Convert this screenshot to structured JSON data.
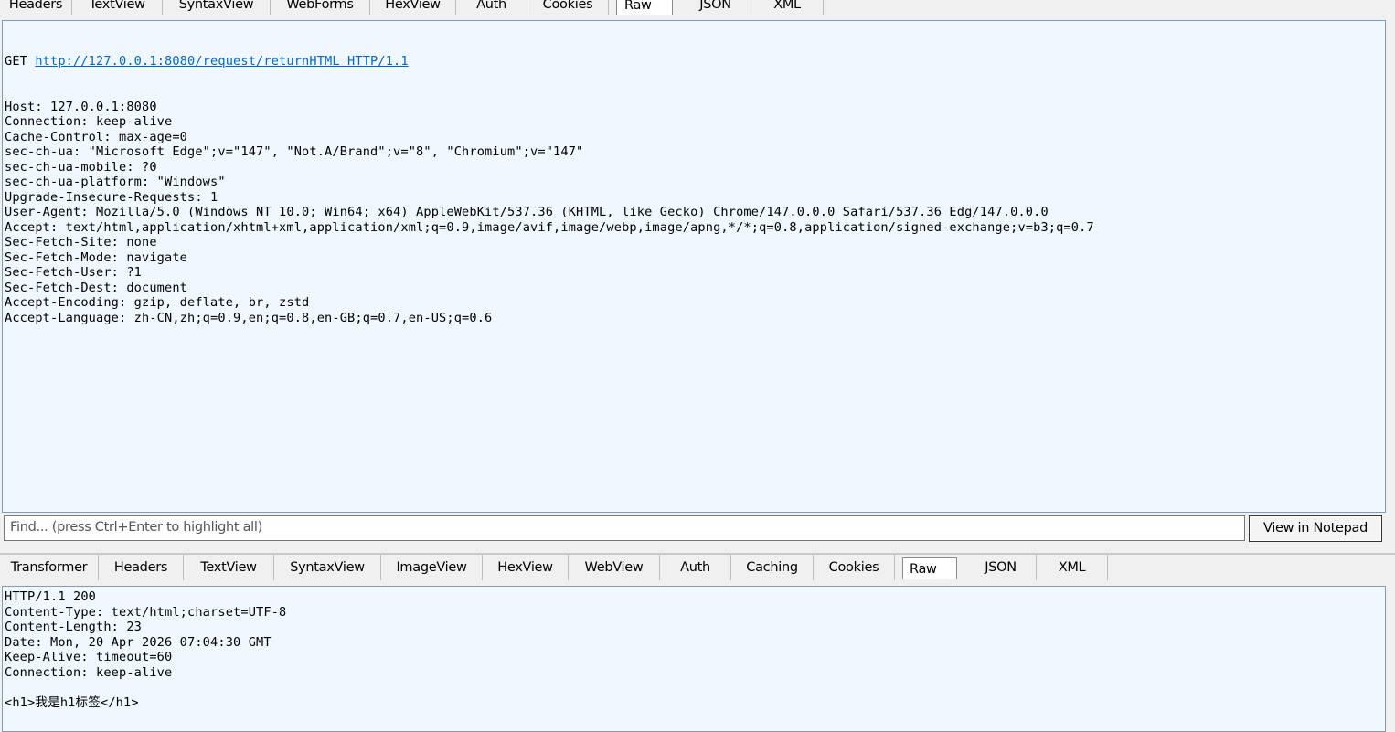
{
  "request": {
    "tabs": [
      "Headers",
      "TextView",
      "SyntaxView",
      "WebForms",
      "HexView",
      "Auth",
      "Cookies",
      "Raw",
      "JSON",
      "XML"
    ],
    "active_tab": "Raw",
    "raw": {
      "method": "GET ",
      "url": "http://127.0.0.1:8080/request/returnHTML HTTP/1.1",
      "lines": [
        "Host: 127.0.0.1:8080",
        "Connection: keep-alive",
        "Cache-Control: max-age=0",
        "sec-ch-ua: \"Microsoft Edge\";v=\"147\", \"Not.A/Brand\";v=\"8\", \"Chromium\";v=\"147\"",
        "sec-ch-ua-mobile: ?0",
        "sec-ch-ua-platform: \"Windows\"",
        "Upgrade-Insecure-Requests: 1",
        "User-Agent: Mozilla/5.0 (Windows NT 10.0; Win64; x64) AppleWebKit/537.36 (KHTML, like Gecko) Chrome/147.0.0.0 Safari/537.36 Edg/147.0.0.0",
        "Accept: text/html,application/xhtml+xml,application/xml;q=0.9,image/avif,image/webp,image/apng,*/*;q=0.8,application/signed-exchange;v=b3;q=0.7",
        "Sec-Fetch-Site: none",
        "Sec-Fetch-Mode: navigate",
        "Sec-Fetch-User: ?1",
        "Sec-Fetch-Dest: document",
        "Accept-Encoding: gzip, deflate, br, zstd",
        "Accept-Language: zh-CN,zh;q=0.9,en;q=0.8,en-GB;q=0.7,en-US;q=0.6"
      ]
    },
    "find_placeholder": "Find... (press Ctrl+Enter to highlight all)",
    "view_in_notepad": "View in Notepad"
  },
  "response": {
    "tabs": [
      "Transformer",
      "Headers",
      "TextView",
      "SyntaxView",
      "ImageView",
      "HexView",
      "WebView",
      "Auth",
      "Caching",
      "Cookies",
      "Raw",
      "JSON",
      "XML"
    ],
    "active_tab": "Raw",
    "raw_lines": [
      "HTTP/1.1 200",
      "Content-Type: text/html;charset=UTF-8",
      "Content-Length: 23",
      "Date: Mon, 20 Apr 2026 07:04:30 GMT",
      "Keep-Alive: timeout=60",
      "Connection: keep-alive",
      "",
      "<h1>我是h1标签</h1>"
    ]
  },
  "colors": {
    "pane_background": "#f0f7ff",
    "link": "#0066cc",
    "chrome": "#f0f0f0"
  }
}
